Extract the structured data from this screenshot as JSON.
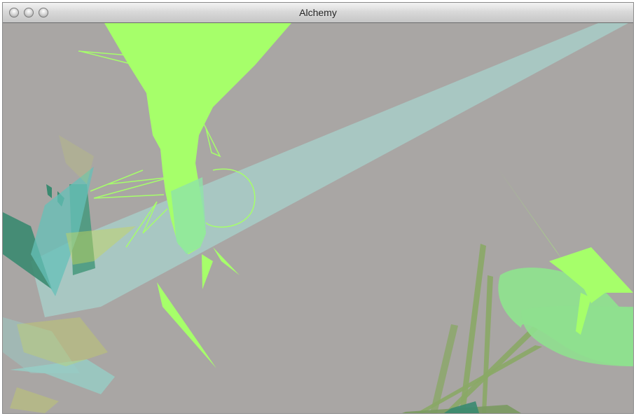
{
  "window": {
    "title": "Alchemy",
    "controls": [
      "close",
      "minimize",
      "zoom"
    ]
  },
  "canvas": {
    "background_color": "#a9a6a4",
    "palette": {
      "lime": "#a6ff6a",
      "light_cyan": "#a8ccc8",
      "teal": "#3a8a70",
      "mint": "#8fe08f",
      "olive": "#8aa866",
      "yellow_green": "#c8d85a"
    }
  }
}
